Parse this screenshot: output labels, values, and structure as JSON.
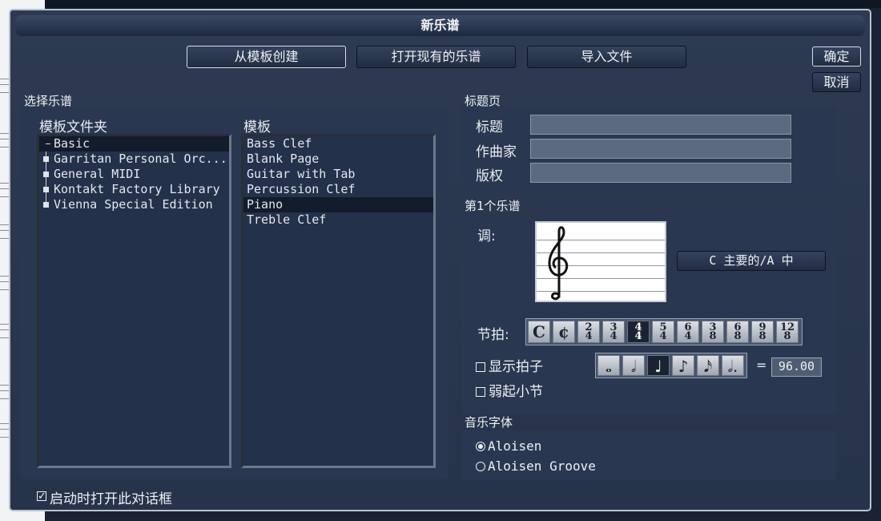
{
  "dialog": {
    "title": "新乐谱",
    "tabs": [
      "从模板创建",
      "打开现有的乐谱",
      "导入文件"
    ],
    "ok_label": "确定",
    "cancel_label": "取消",
    "startup_checkbox": {
      "label": "启动时打开此对话框",
      "checked": true
    }
  },
  "select_score": {
    "section_label": "选择乐谱",
    "folders_label": "模板文件夹",
    "templates_label": "模板",
    "folders": [
      "Basic",
      "Garritan Personal Orc...",
      "General MIDI",
      "Kontakt Factory Library",
      "Vienna Special Edition"
    ],
    "selected_folder": "Basic",
    "templates": [
      "Bass Clef",
      "Blank Page",
      "Guitar with Tab",
      "Percussion Clef",
      "Piano",
      "Treble Clef"
    ],
    "selected_template": "Piano"
  },
  "title_page": {
    "section_label": "标题页",
    "title_label": "标题",
    "composer_label": "作曲家",
    "copyright_label": "版权",
    "title_value": "",
    "composer_value": "",
    "copyright_value": ""
  },
  "first_staff": {
    "section_label": "第1个乐谱",
    "key_label": "调:",
    "key_value": "C 主要的/A 中",
    "meter_label": "节拍:",
    "time_signatures": [
      {
        "top": "C",
        "bottom": ""
      },
      {
        "top": "¢",
        "bottom": ""
      },
      {
        "top": "2",
        "bottom": "4"
      },
      {
        "top": "3",
        "bottom": "4"
      },
      {
        "top": "4",
        "bottom": "4"
      },
      {
        "top": "5",
        "bottom": "4"
      },
      {
        "top": "6",
        "bottom": "4"
      },
      {
        "top": "3",
        "bottom": "8"
      },
      {
        "top": "6",
        "bottom": "8"
      },
      {
        "top": "9",
        "bottom": "8"
      },
      {
        "top": "12",
        "bottom": "8"
      }
    ],
    "selected_time_signature": "4/4",
    "show_beat_label": "显示拍子",
    "show_beat_checked": false,
    "pickup_label": "弱起小节",
    "pickup_checked": false,
    "note_values": [
      "whole-note-icon",
      "half-note-icon",
      "quarter-note-icon",
      "eighth-note-icon",
      "sixteenth-note-icon",
      "dotted-half-note-icon"
    ],
    "note_glyphs": [
      "𝅝",
      "𝅗𝅥",
      "♩",
      "♪",
      "𝅘𝅥𝅯",
      "𝅗𝅥."
    ],
    "selected_note": "quarter-note-icon",
    "equals_sign": "=",
    "tempo": "96.00"
  },
  "music_font": {
    "section_label": "音乐字体",
    "options": [
      "Aloisen",
      "Aloisen Groove"
    ],
    "selected": "Aloisen"
  },
  "colors": {
    "dialog_bg": "#2d3a52",
    "panel_bg": "#2a3750",
    "selection": "#131b2c"
  }
}
